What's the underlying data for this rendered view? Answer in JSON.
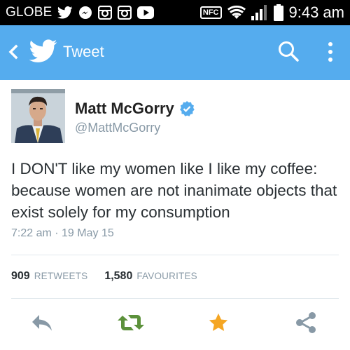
{
  "status_bar": {
    "carrier": "GLOBE",
    "icons": [
      "twitter-icon",
      "messenger-icon",
      "instagram-icon",
      "instagram-icon",
      "youtube-icon"
    ],
    "nfc_label": "NFC",
    "time": "9:43 am"
  },
  "app_bar": {
    "title": "Tweet",
    "background": "#55acee"
  },
  "tweet": {
    "author_name": "Matt McGorry",
    "author_handle": "@MattMcGorry",
    "verified": true,
    "text": "I DON'T like my women like I like my coffee: because women are not inanimate objects that exist solely for my consumption",
    "timestamp": "7:22 am · 19 May 15",
    "retweet_count": "909",
    "retweet_label": "RETWEETS",
    "favourite_count": "1,580",
    "favourite_label": "FAVOURITES"
  },
  "actions": {
    "icons": [
      "reply-icon",
      "retweet-icon",
      "favourite-star-icon",
      "share-icon"
    ],
    "colors": {
      "reply": "#8899a6",
      "retweet": "#5c913b",
      "favourite": "#f5a623",
      "share": "#8899a6"
    }
  }
}
